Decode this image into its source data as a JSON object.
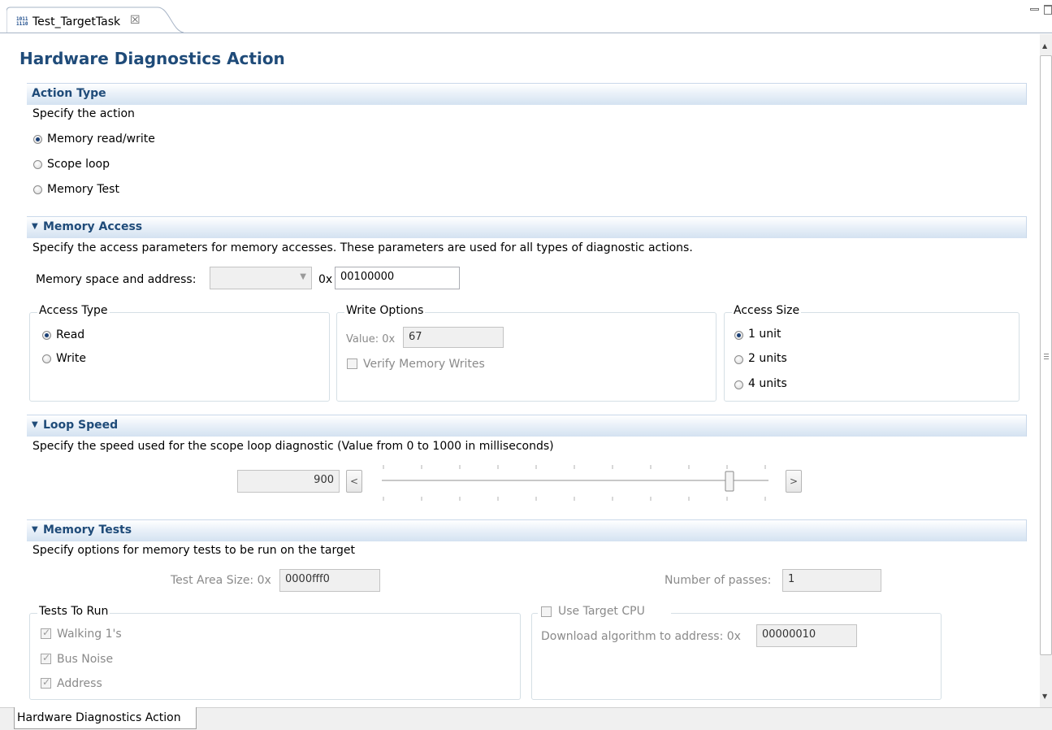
{
  "tab": {
    "icon_text": "1011\n1110",
    "title": "Test_TargetTask",
    "close_glyph": "☒"
  },
  "page_title": "Hardware Diagnostics Action",
  "action_type": {
    "header": "Action Type",
    "description": "Specify the action",
    "options": [
      {
        "label": "Memory read/write",
        "selected": true
      },
      {
        "label": "Scope loop",
        "selected": false
      },
      {
        "label": "Memory Test",
        "selected": false
      }
    ]
  },
  "memory_access": {
    "header": "Memory Access",
    "description": "Specify the access parameters for memory accesses. These parameters are used for all types of diagnostic actions.",
    "address_label": "Memory space and address:",
    "hex_prefix": "0x",
    "address_value": "00100000",
    "access_type": {
      "title": "Access Type",
      "options": [
        {
          "label": "Read",
          "selected": true
        },
        {
          "label": "Write",
          "selected": false
        }
      ]
    },
    "write_options": {
      "title": "Write Options",
      "value_label": "Value: 0x",
      "value": "67",
      "verify_label": "Verify Memory Writes"
    },
    "access_size": {
      "title": "Access Size",
      "options": [
        {
          "label": "1 unit",
          "selected": true
        },
        {
          "label": "2 units",
          "selected": false
        },
        {
          "label": "4 units",
          "selected": false
        }
      ]
    }
  },
  "loop_speed": {
    "header": "Loop Speed",
    "description": "Specify the speed used for the scope loop diagnostic (Value from 0 to 1000 in milliseconds)",
    "value": "900",
    "min": 0,
    "max": 1000,
    "decrement_label": "<",
    "increment_label": ">"
  },
  "memory_tests": {
    "header": "Memory Tests",
    "description": "Specify options for memory tests to be run on the target",
    "test_area_label": "Test Area Size: 0x",
    "test_area_value": "0000fff0",
    "passes_label": "Number of passes:",
    "passes_value": "1",
    "tests_to_run": {
      "title": "Tests To Run",
      "items": [
        {
          "label": "Walking 1's",
          "checked": true
        },
        {
          "label": "Bus Noise",
          "checked": true
        },
        {
          "label": "Address",
          "checked": true
        }
      ]
    },
    "target_cpu": {
      "title": "Use Target CPU",
      "download_label": "Download algorithm to address: 0x",
      "download_value": "00000010"
    }
  },
  "bottom_tab": {
    "label": "Hardware Diagnostics Action"
  },
  "colors": {
    "header_text": "#1f4b79",
    "accent_radio": "#1a3f75"
  }
}
